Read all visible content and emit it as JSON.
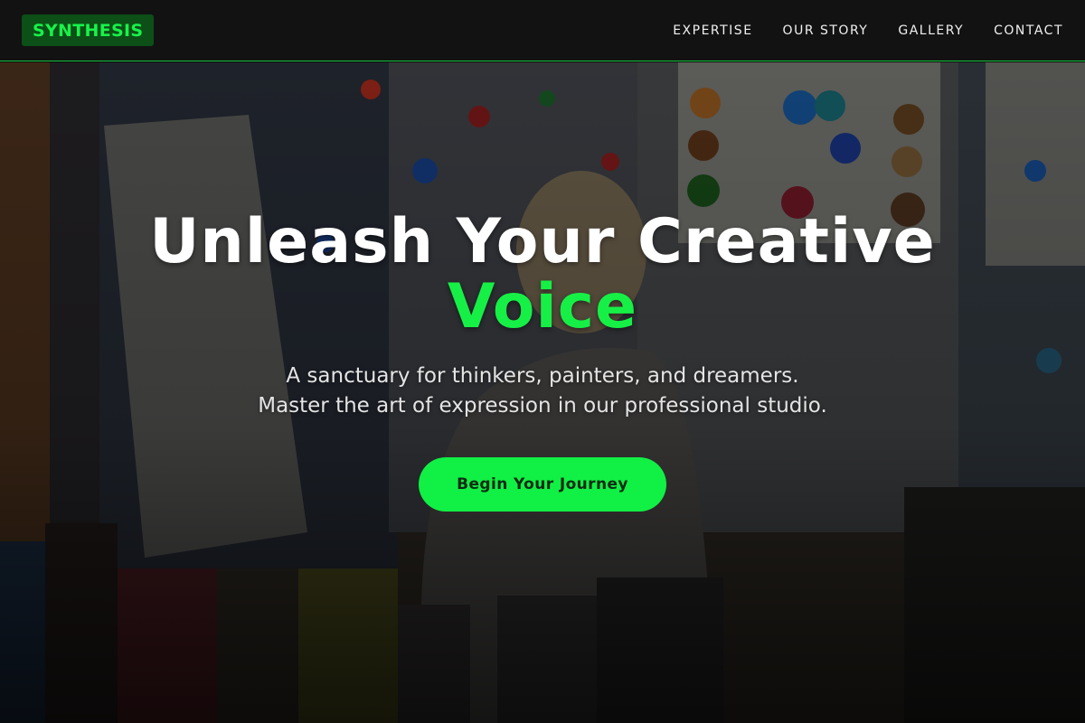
{
  "brand": {
    "logo_text": "SYNTHESIS",
    "accent_color": "#16f046"
  },
  "nav": {
    "items": [
      {
        "label": "EXPERTISE"
      },
      {
        "label": "OUR STORY"
      },
      {
        "label": "GALLERY"
      },
      {
        "label": "CONTACT"
      }
    ]
  },
  "hero": {
    "headline": "Unleash Your Creative",
    "headline_accent": "Voice",
    "subtitle_line1": "A sanctuary for thinkers, painters, and dreamers.",
    "subtitle_line2": "Master the art of expression in our professional studio.",
    "cta_label": "Begin Your Journey",
    "background_image": "paint-studio-photo"
  }
}
